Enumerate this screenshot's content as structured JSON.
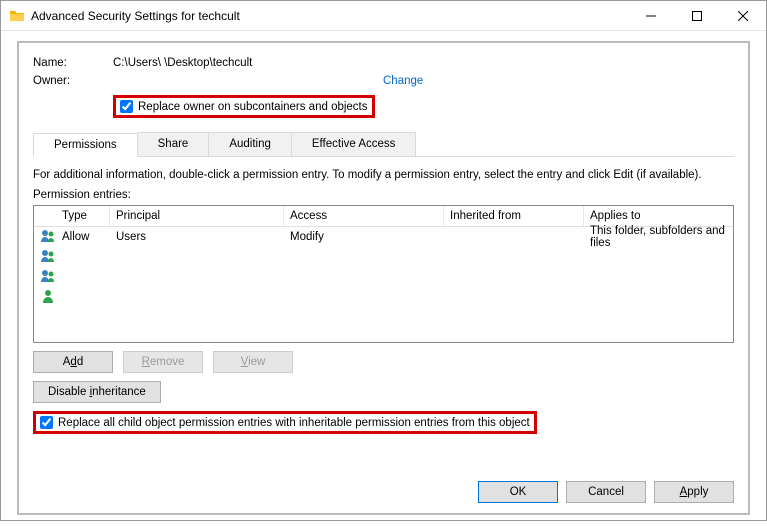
{
  "window": {
    "title": "Advanced Security Settings for techcult"
  },
  "labels": {
    "name": "Name:",
    "owner": "Owner:",
    "name_value": "C:\\Users\\                               \\Desktop\\techcult",
    "change_link": "Change",
    "replace_owner": "Replace owner on subcontainers and objects",
    "info": "For additional information, double-click a permission entry. To modify a permission entry, select the entry and click Edit (if available).",
    "entries": "Permission entries:",
    "replace_children": "Replace all child object permission entries with inheritable permission entries from this object"
  },
  "tabs": {
    "permissions": "Permissions",
    "share": "Share",
    "auditing": "Auditing",
    "effective": "Effective Access"
  },
  "headers": {
    "type": "Type",
    "principal": "Principal",
    "access": "Access",
    "inherited": "Inherited from",
    "applies": "Applies to"
  },
  "entries_data": [
    {
      "type": "Allow",
      "principal": "Users",
      "access": "Modify",
      "inherited": "",
      "applies": "This folder, subfolders and files"
    },
    {
      "type": "",
      "principal": "",
      "access": "",
      "inherited": "",
      "applies": ""
    },
    {
      "type": "",
      "principal": "",
      "access": "",
      "inherited": "",
      "applies": ""
    },
    {
      "type": "",
      "principal": "",
      "access": "",
      "inherited": "",
      "applies": ""
    }
  ],
  "buttons": {
    "add": "Add",
    "remove": "Remove",
    "view": "View",
    "disable_inh": "Disable inheritance",
    "ok": "OK",
    "cancel": "Cancel",
    "apply": "Apply"
  }
}
